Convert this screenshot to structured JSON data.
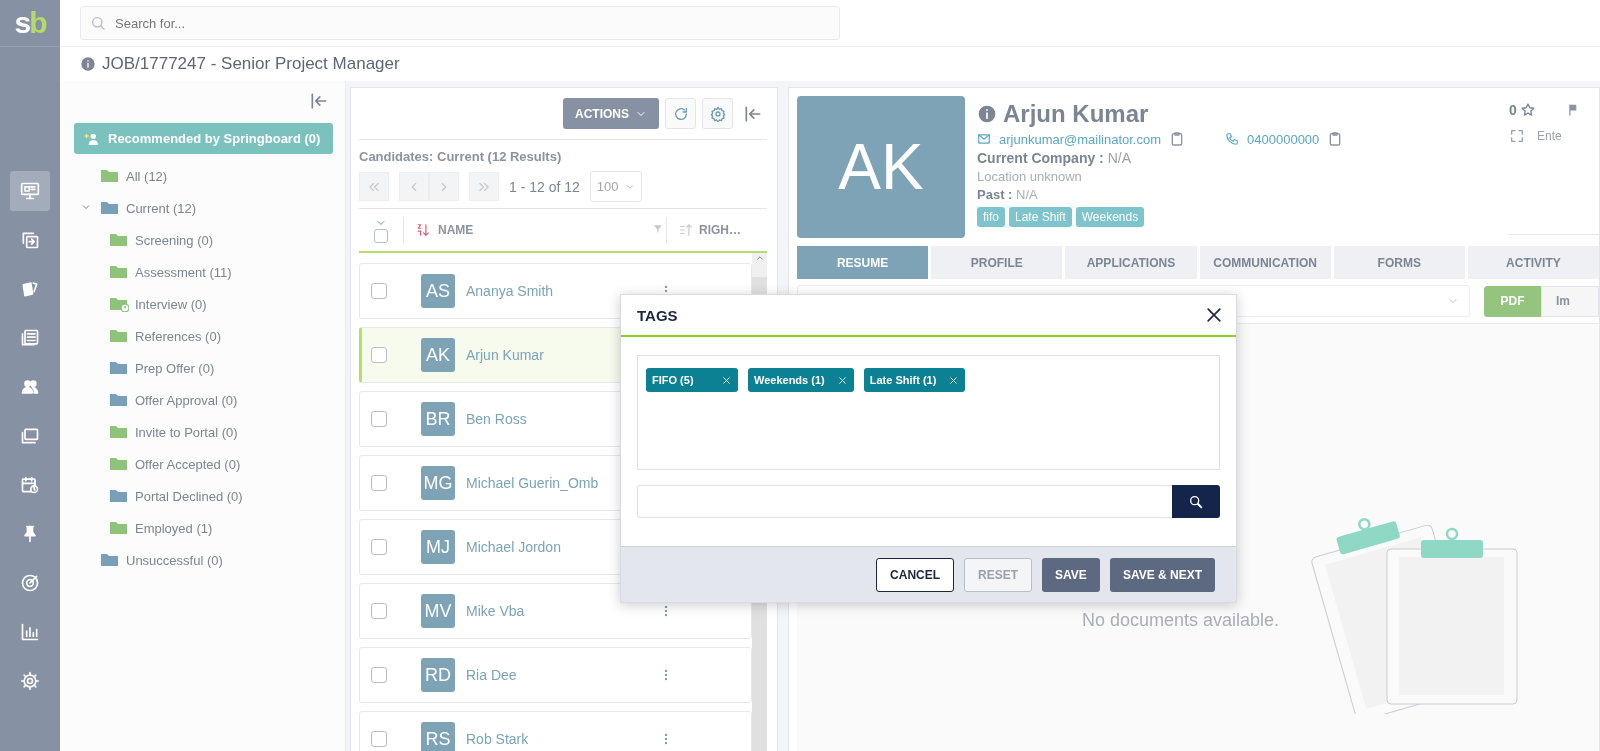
{
  "logo": [
    "s",
    "b"
  ],
  "nav_items": [
    {
      "selected": true
    },
    {
      "selected": false
    },
    {
      "selected": false
    },
    {
      "selected": false
    },
    {
      "selected": false
    },
    {
      "selected": false
    },
    {
      "selected": false
    },
    {
      "selected": false
    },
    {
      "selected": false
    },
    {
      "selected": false
    },
    {
      "selected": false
    }
  ],
  "search": {
    "placeholder": "Search for..."
  },
  "job_title": "JOB/1777247 - Senior Project Manager",
  "stages": {
    "recommended": "Recommended by Springboard (0)",
    "tree": [
      {
        "label": "All (12)",
        "color": "#8fc27a",
        "alert": false
      },
      {
        "label": "Current (12)",
        "color": "#7a9fb8",
        "alert": false,
        "expanded": true,
        "children": [
          {
            "label": "Screening (0)",
            "color": "#8fc27a",
            "alert": false
          },
          {
            "label": "Assessment (11)",
            "color": "#8fc27a",
            "alert": false
          },
          {
            "label": "Interview (0)",
            "color": "#8fc27a",
            "alert": true
          },
          {
            "label": "References (0)",
            "color": "#8fc27a",
            "alert": false
          },
          {
            "label": "Prep Offer (0)",
            "color": "#7a9fb8",
            "alert": false
          },
          {
            "label": "Offer Approval (0)",
            "color": "#7a9fb8",
            "alert": false
          },
          {
            "label": "Invite to Portal (0)",
            "color": "#8fc27a",
            "alert": false
          },
          {
            "label": "Offer Accepted (0)",
            "color": "#8fc27a",
            "alert": false
          },
          {
            "label": "Portal Declined (0)",
            "color": "#7a9fb8",
            "alert": false
          },
          {
            "label": "Employed (1)",
            "color": "#8fc27a",
            "alert": false
          }
        ]
      },
      {
        "label": "Unsuccessful (0)",
        "color": "#7a9fb8",
        "alert": false
      }
    ]
  },
  "candidates": {
    "actions": "ACTIONS",
    "summary": "Candidates: Current (12 Results)",
    "pager": {
      "range": "1 - 12 of 12",
      "page_size": "100"
    },
    "select_all": false,
    "columns": [
      "NAME",
      "RIGH…"
    ],
    "rows": [
      {
        "initials": "AS",
        "name": "Ananya Smith",
        "checked": false,
        "selected": false
      },
      {
        "initials": "AK",
        "name": "Arjun Kumar",
        "checked": false,
        "selected": true
      },
      {
        "initials": "BR",
        "name": "Ben Ross",
        "checked": false,
        "selected": false
      },
      {
        "initials": "MG",
        "name": "Michael Guerin_Omb",
        "checked": false,
        "selected": false
      },
      {
        "initials": "MJ",
        "name": "Michael Jordon",
        "checked": false,
        "selected": false
      },
      {
        "initials": "MV",
        "name": "Mike Vba",
        "checked": false,
        "selected": false
      },
      {
        "initials": "RD",
        "name": "Ria Dee",
        "checked": false,
        "selected": false
      },
      {
        "initials": "RS",
        "name": "Rob Stark",
        "checked": false,
        "selected": false
      }
    ]
  },
  "profile": {
    "initials": "AK",
    "name": "Arjun Kumar",
    "email": "arjunkumar@mailinator.com",
    "phone": "0400000000",
    "company_label": "Current Company :",
    "company": "N/A",
    "location": "Location unknown",
    "past_label": "Past :",
    "past": "N/A",
    "tags": [
      "fifo",
      "Late Shift",
      "Weekends"
    ],
    "rating": "0",
    "extra_label": "Ente",
    "tabs": [
      {
        "label": "RESUME",
        "selected": true
      },
      {
        "label": "PROFILE",
        "selected": false
      },
      {
        "label": "APPLICATIONS",
        "selected": false
      },
      {
        "label": "COMMUNICATION",
        "selected": false
      },
      {
        "label": "FORMS",
        "selected": false
      },
      {
        "label": "ACTIVITY",
        "selected": false
      }
    ],
    "doc_formats": [
      {
        "label": "PDF",
        "selected": true
      },
      {
        "label": "Im",
        "selected": false
      }
    ],
    "empty_message": "No documents available."
  },
  "modal": {
    "title": "TAGS",
    "tags": [
      "FIFO (5)",
      "Weekends (1)",
      "Late Shift (1)"
    ],
    "buttons": [
      {
        "label": "CANCEL",
        "kind": "outline"
      },
      {
        "label": "RESET",
        "kind": "light"
      },
      {
        "label": "SAVE",
        "kind": "primary"
      },
      {
        "label": "SAVE & NEXT",
        "kind": "primary"
      }
    ]
  }
}
